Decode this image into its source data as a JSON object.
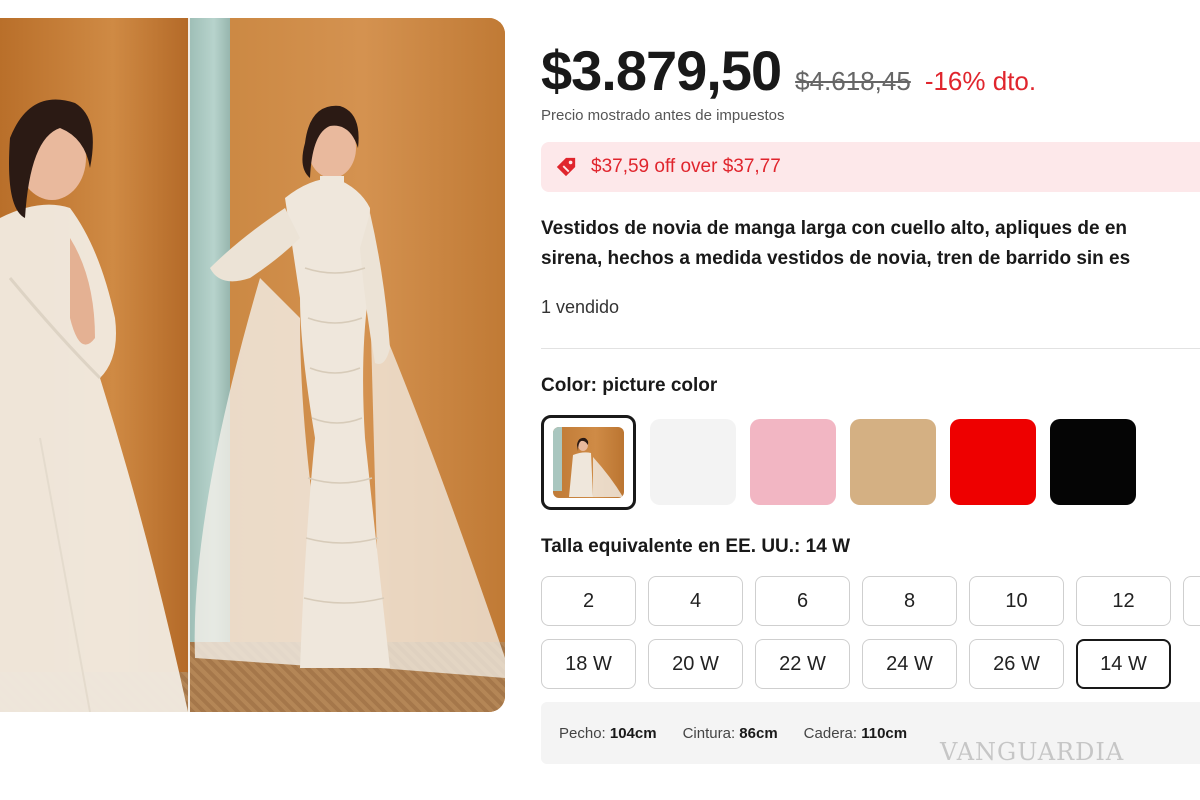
{
  "product": {
    "price": "$3.879,50",
    "old_price": "$4.618,45",
    "discount": "-16% dto.",
    "tax_note": "Precio mostrado antes de impuestos",
    "promo": "$37,59 off over $37,77",
    "title_line1": "Vestidos de novia de manga larga con cuello alto, apliques de en",
    "title_line2": "sirena, hechos a medida vestidos de novia, tren de barrido sin es",
    "sold": "1 vendido"
  },
  "color": {
    "label": "Color:",
    "selected": "picture color",
    "swatches": [
      "#f3f3f3",
      "#f2b6c3",
      "#d4b083",
      "#ee0000",
      "#050505"
    ]
  },
  "size": {
    "label": "Talla equivalente en EE. UU.:",
    "selected": "14 W",
    "row1": [
      "2",
      "4",
      "6",
      "8",
      "10",
      "12"
    ],
    "row2": [
      "18 W",
      "20 W",
      "22 W",
      "24 W",
      "26 W",
      "14 W"
    ]
  },
  "measurements": {
    "chest_label": "Pecho:",
    "chest": "104cm",
    "waist_label": "Cintura:",
    "waist": "86cm",
    "hip_label": "Cadera:",
    "hip": "110cm"
  },
  "watermark": "VANGUARDIA",
  "colors": {
    "accent": "#e0252d",
    "promo_bg": "#fde8ea"
  }
}
